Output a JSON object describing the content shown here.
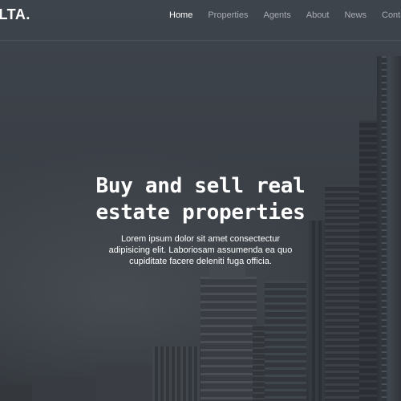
{
  "brand": {
    "logo_text": "ELTA."
  },
  "nav": {
    "items": [
      {
        "label": "Home",
        "active": true
      },
      {
        "label": "Properties",
        "active": false
      },
      {
        "label": "Agents",
        "active": false
      },
      {
        "label": "About",
        "active": false
      },
      {
        "label": "News",
        "active": false
      },
      {
        "label": "Contac",
        "active": false
      }
    ]
  },
  "hero": {
    "title_lines": [
      "Buy and sell real",
      "estate properties"
    ],
    "text_lines": [
      "Lorem ipsum dolor sit amet consectectur",
      "adipisicing elit. Laboriosam assumenda ea quo",
      "cupiditate facere deleniti fuga officia."
    ]
  },
  "colors": {
    "overlay": "#3b3f45",
    "text_primary": "#ffffff",
    "nav_inactive": "#a9adb3"
  }
}
